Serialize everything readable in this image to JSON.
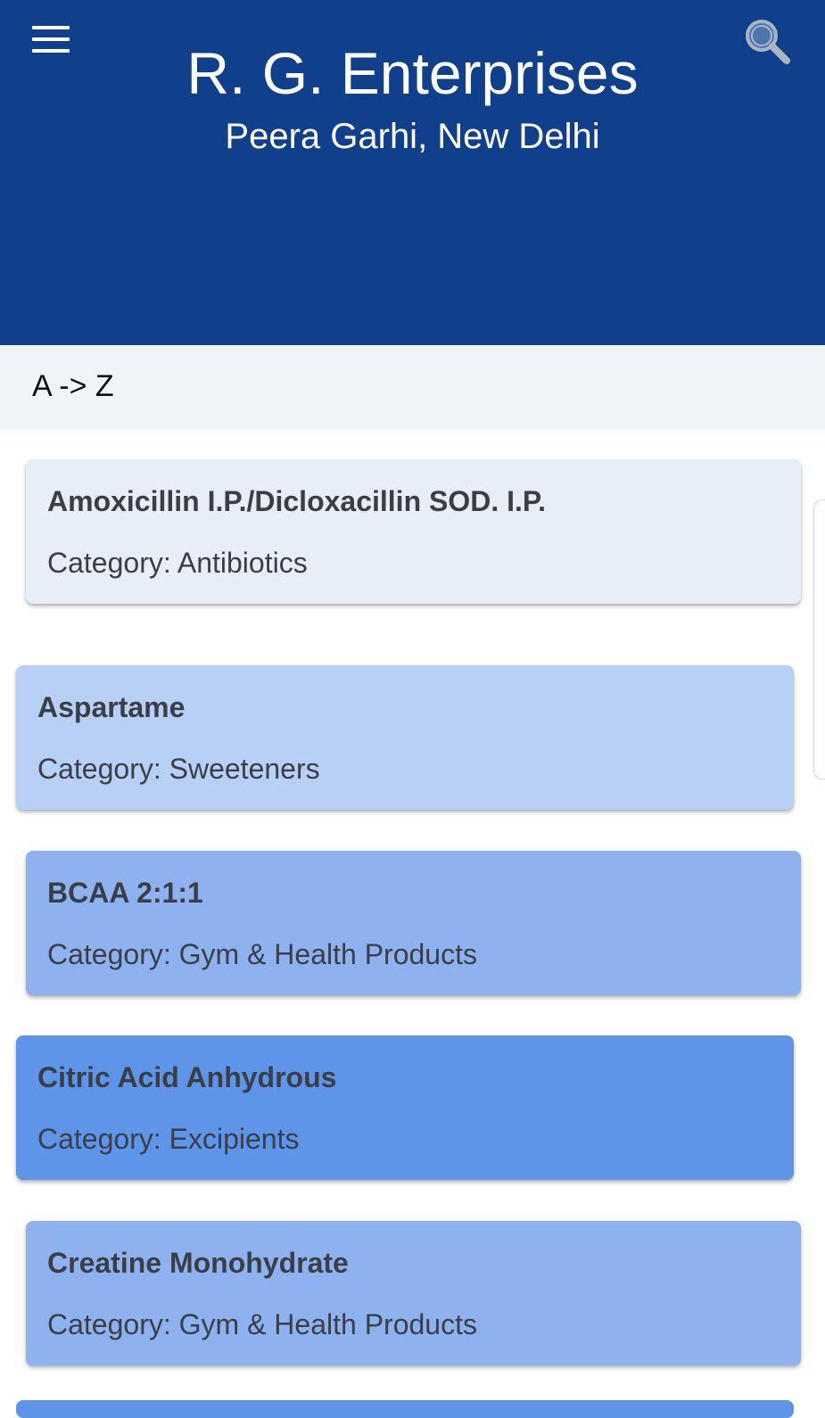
{
  "header": {
    "title": "R. G. Enterprises",
    "subtitle": "Peera Garhi, New Delhi",
    "background": "#103f8c",
    "menu_icon": "hamburger-menu-icon",
    "search_icon": "search-icon"
  },
  "sort": {
    "label": "A -> Z"
  },
  "products": [
    {
      "name": "Amoxicillin I.P./Dicloxacillin SOD. I.P.",
      "category": "Category: Antibiotics",
      "color": "#e8eef8"
    },
    {
      "name": "Aspartame",
      "category": "Category: Sweeteners",
      "color": "#b8d0f6"
    },
    {
      "name": "BCAA 2:1:1",
      "category": "Category: Gym & Health Products",
      "color": "#8eb2f0"
    },
    {
      "name": "Citric Acid Anhydrous",
      "category": "Category: Excipients",
      "color": "#5e95e8"
    },
    {
      "name": "Creatine Monohydrate",
      "category": "Category: Gym & Health Products",
      "color": "#8eb2f0"
    }
  ]
}
